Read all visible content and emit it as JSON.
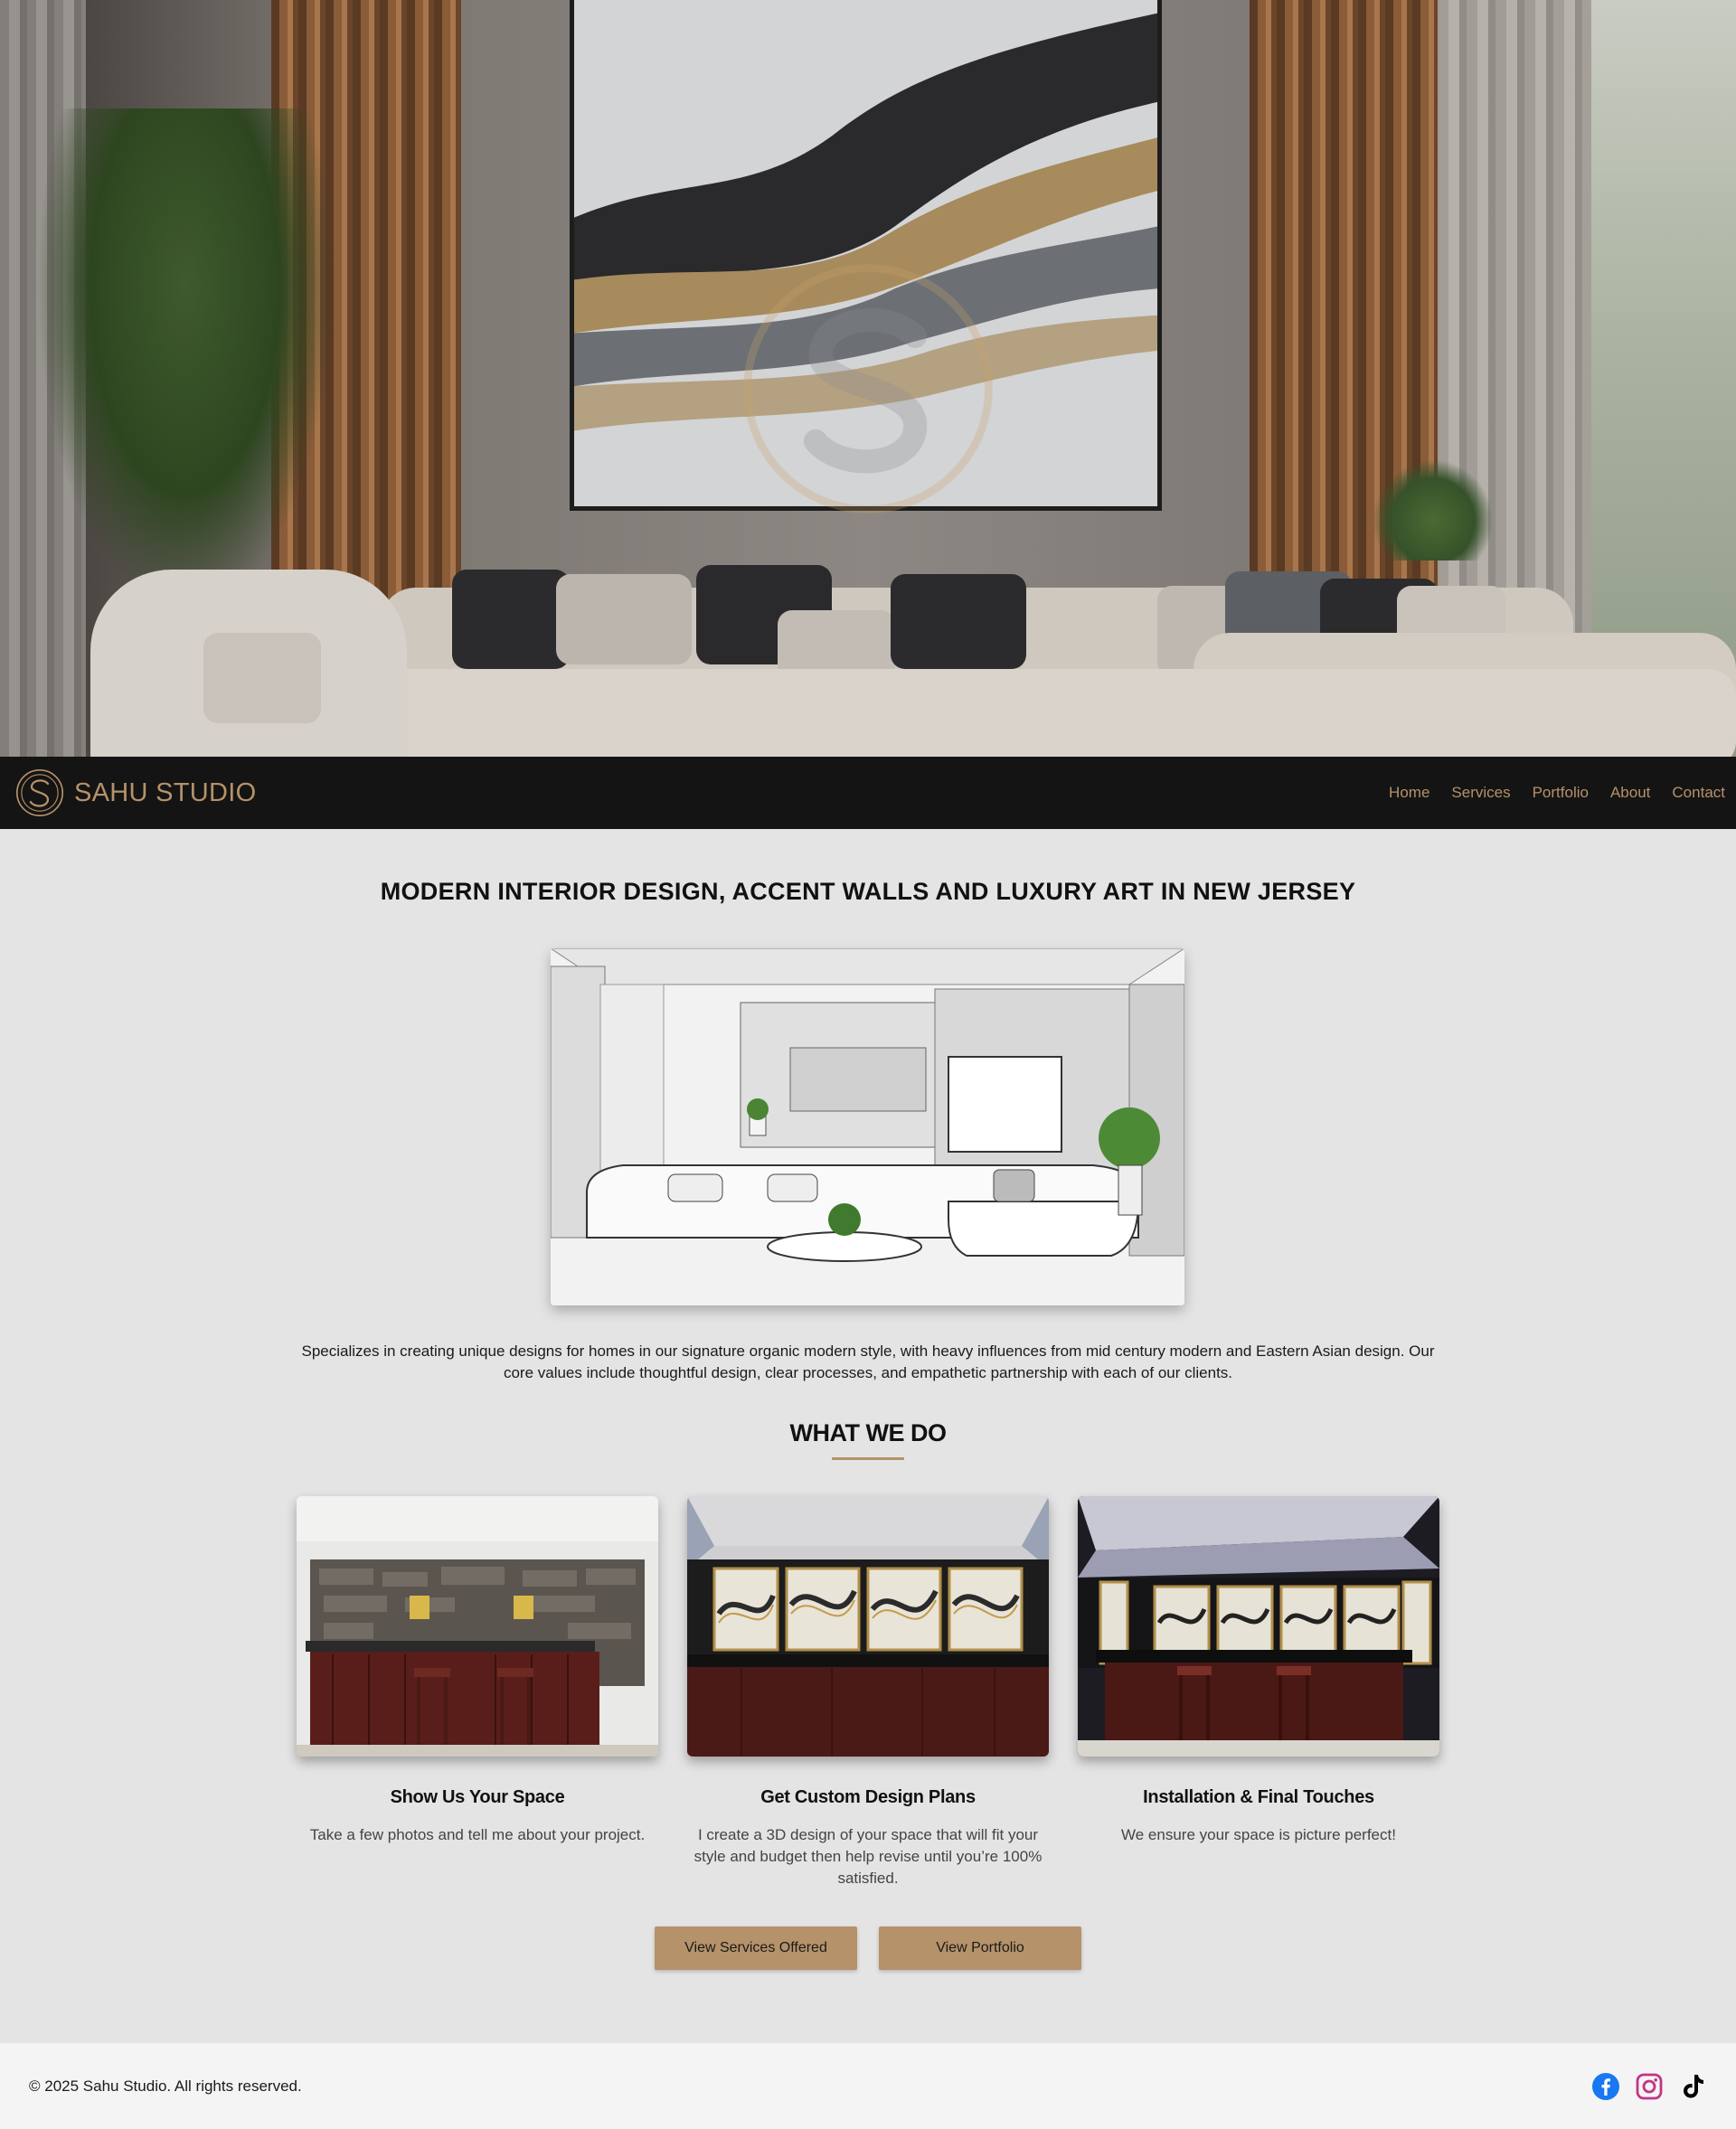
{
  "brand": {
    "name": "SAHU STUDIO",
    "accent_color": "#b5926a",
    "logo_icon": "sahu-s-logo-icon"
  },
  "nav": {
    "items": [
      {
        "label": "Home"
      },
      {
        "label": "Services"
      },
      {
        "label": "Portfolio"
      },
      {
        "label": "About"
      },
      {
        "label": "Contact"
      }
    ]
  },
  "main": {
    "headline": "MODERN INTERIOR DESIGN, ACCENT WALLS AND LUXURY ART IN NEW JERSEY",
    "intro": "Specializes in creating unique designs for homes in our signature organic modern style, with heavy influences from mid century modern and Eastern Asian design. Our core values include thoughtful design, clear processes, and empathetic partnership with each of our clients.",
    "section_title": "WHAT WE DO",
    "cards": [
      {
        "title": "Show Us Your Space",
        "description": "Take a few photos and tell me about your project."
      },
      {
        "title": "Get Custom Design Plans",
        "description": "I create a 3D design of your space that will fit your style and budget then help revise until you’re 100% satisfied."
      },
      {
        "title": "Installation & Final Touches",
        "description": "We ensure your space is picture perfect!"
      }
    ],
    "buttons": {
      "services": "View Services Offered",
      "portfolio": "View Portfolio"
    }
  },
  "footer": {
    "copyright": "© 2025 Sahu Studio. All rights reserved.",
    "socials": [
      {
        "icon": "facebook-icon",
        "color": "#1877f2"
      },
      {
        "icon": "instagram-icon",
        "color": "#c13584"
      },
      {
        "icon": "tiktok-icon",
        "color": "#000000"
      }
    ]
  }
}
